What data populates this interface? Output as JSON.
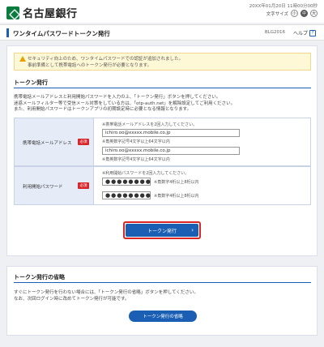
{
  "header": {
    "bank_name": "名古屋銀行",
    "datetime": "20XX年01月20日 11時00分00秒",
    "fontsize_label": "文字サイズ",
    "fontsize_options": [
      "小",
      "中",
      "大"
    ],
    "fontsize_selected": "中"
  },
  "titlebar": {
    "title": "ワンタイムパスワードトークン発行",
    "page_id": "BLG2016",
    "help_label": "ヘルプ",
    "help_icon": "?"
  },
  "notice": {
    "line1": "セキュリティ向上のため、ワンタイムパスワードでの認証が追加されました。",
    "line2": "事前準備として携帯電話へのトークン発行が必要となります。"
  },
  "token_section": {
    "heading": "トークン発行",
    "desc_line1": "携帯電話メールアドレスと利用開始パスワードを入力の上、「トークン発行」ボタンを押してください。",
    "desc_line2": "迷惑メールフィルター等で受信メール対策をしている方は、「otp-auth.net」を解除設定してご利用ください。",
    "desc_line3": "また、利用開始パスワードはトークンアプリの初期設定時に必要となる情報となります。",
    "required_label": "必須",
    "email": {
      "label": "携帯電話メールアドレス",
      "note": "※携帯電話メールアドレスを2回入力してください。",
      "value1": "ichiro.oo@xxxxx.mobile.co.jp",
      "hint1": "※角英数字記号4文字以上64文字以内",
      "value2": "ichiro.oo@xxxxx.mobile.co.jp",
      "hint2": "※角英数字記号4文字以上64文字以内"
    },
    "password": {
      "label": "利用開始パスワード",
      "note": "※利用開始パスワードを2回入力してください。",
      "value1": "●●●●●●●●",
      "hint1": "※角数字4桁以上8桁以内",
      "value2": "●●●●●●●●",
      "hint2": "※角数字4桁以上8桁以内"
    },
    "issue_button": "トークン発行",
    "issue_chevron": "›"
  },
  "howto_section": {
    "heading": "トークン発行の省略",
    "desc_line1": "すぐにトークン発行を行わない場合には、「トークン発行の省略」ボタンを押してください。",
    "desc_line2": "なお、次回ログイン時に改めてトークン発行が可能です。",
    "button": "トークン発行の省略"
  }
}
